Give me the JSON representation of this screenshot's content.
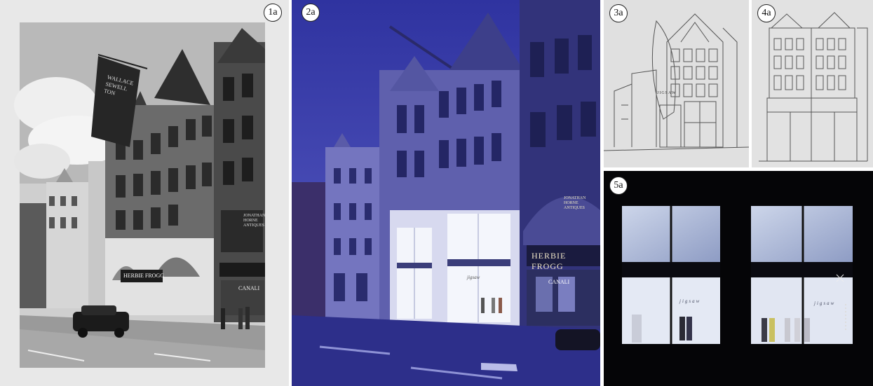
{
  "panels": [
    {
      "id": "1a",
      "label": "1a"
    },
    {
      "id": "2a",
      "label": "2a"
    },
    {
      "id": "3a",
      "label": "3a"
    },
    {
      "id": "4a",
      "label": "4a"
    },
    {
      "id": "5a",
      "label": "5a"
    }
  ],
  "signage": {
    "banner": "WALLACE SEWELL TON",
    "shopfront_1a": "HERBIE FROGG",
    "antiques_1a": "JONATHAN HORNE ANTIQUES",
    "canali": "CANALI",
    "herbie_2a": "HERBIE FROGG",
    "antiques_2a": "JONATHAN HORNE ANTIQUES",
    "jigsaw_sign": "JIGSAW",
    "jigsaw_glass": "jigsaw"
  },
  "colors": {
    "dusk_sky": "#3c3fa8",
    "facade_night": "#6a6bb8",
    "window_glow": "#e9edf6",
    "night_black": "#050507"
  }
}
